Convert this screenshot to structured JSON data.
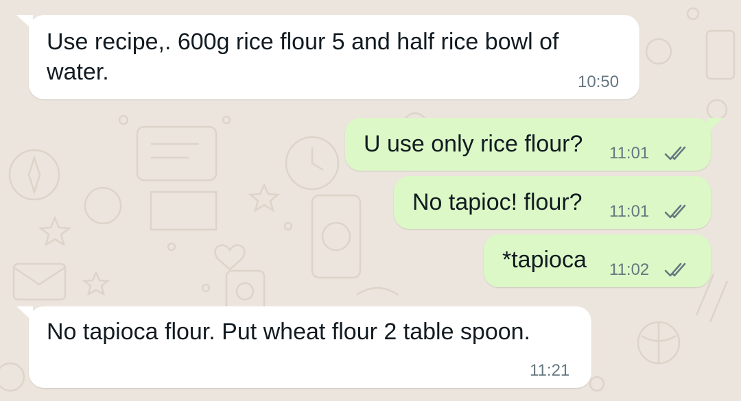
{
  "theme": {
    "wallpaper": "#ece5dd",
    "incoming_bubble": "#ffffff",
    "outgoing_bubble": "#dcf8c6",
    "text_color": "#111b21",
    "time_color": "#667781",
    "tick_color": "#667781"
  },
  "messages": [
    {
      "direction": "incoming",
      "lines": [
        "Use recipe,. 600g rice flour 5 and half rice bowl of",
        "water."
      ],
      "time": "10:50"
    },
    {
      "direction": "outgoing",
      "lines": [
        "U use only rice flour?"
      ],
      "time": "11:01",
      "status": "double-tick-icon"
    },
    {
      "direction": "outgoing",
      "lines": [
        "No tapioc! flour?"
      ],
      "time": "11:01",
      "status": "double-tick-icon"
    },
    {
      "direction": "outgoing",
      "lines": [
        "*tapioca"
      ],
      "time": "11:02",
      "status": "double-tick-icon"
    },
    {
      "direction": "incoming",
      "lines": [
        "No tapioca flour. Put wheat flour 2 table spoon."
      ],
      "time": "11:21"
    }
  ]
}
